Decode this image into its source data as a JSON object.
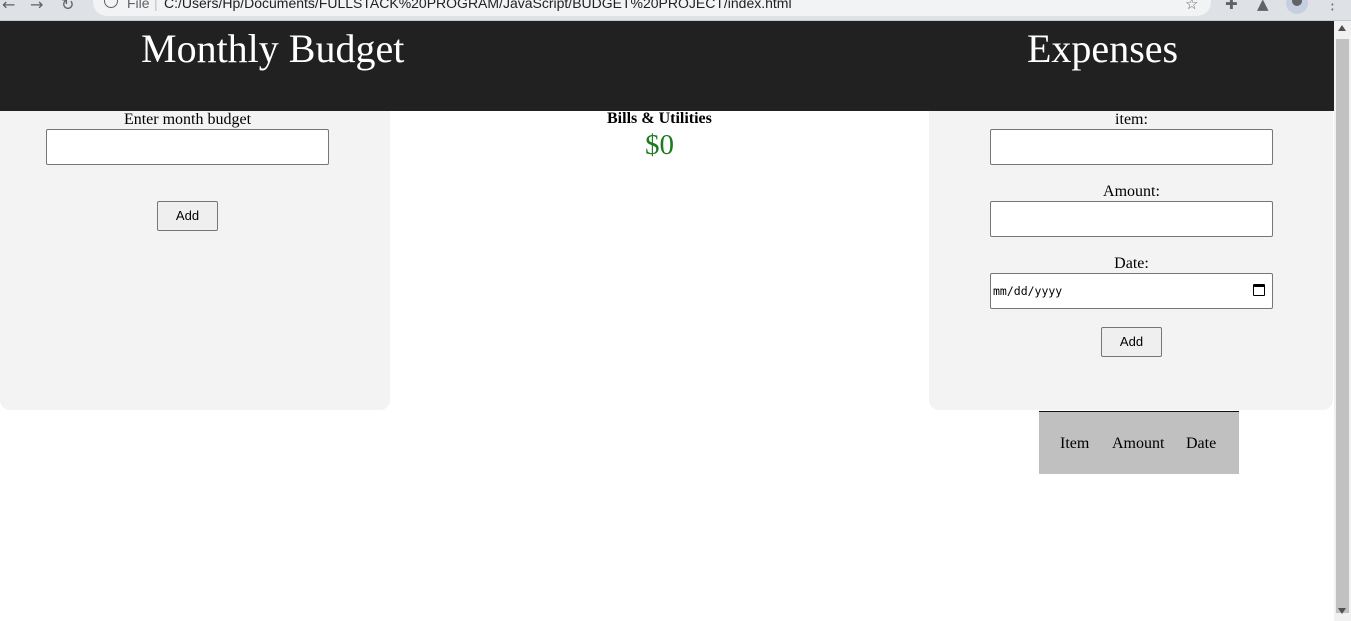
{
  "browser": {
    "file_label": "File",
    "separator": "|",
    "url": "C:/Users/Hp/Documents/FULLSTACK%20PROGRAM/JavaScript/BUDGET%20PROJECT/index.html",
    "icons": [
      "back-icon",
      "forward-icon",
      "reload-icon",
      "info-icon",
      "star-icon",
      "extensions-icon",
      "extension-icon",
      "profile-avatar",
      "menu-icon"
    ]
  },
  "header": {
    "budget_title": "Monthly Budget",
    "expenses_title": "Expenses"
  },
  "budget_panel": {
    "label": "Enter month budget",
    "input_value": "",
    "add_label": "Add"
  },
  "summary": {
    "category": "Bills & Utilities",
    "amount": "$0"
  },
  "expense_form": {
    "item_label": "item:",
    "item_value": "",
    "amount_label": "Amount:",
    "amount_value": "",
    "date_label": "Date:",
    "date_placeholder": "mm/dd/yyyy",
    "add_label": "Add"
  },
  "expense_table": {
    "headers": [
      "Item",
      "Amount",
      "Date"
    ]
  },
  "colors": {
    "header_bg": "#212121",
    "panel_bg": "#f3f3f3",
    "amount_color": "#1f7a1f",
    "table_bg": "#c0c0c0"
  }
}
